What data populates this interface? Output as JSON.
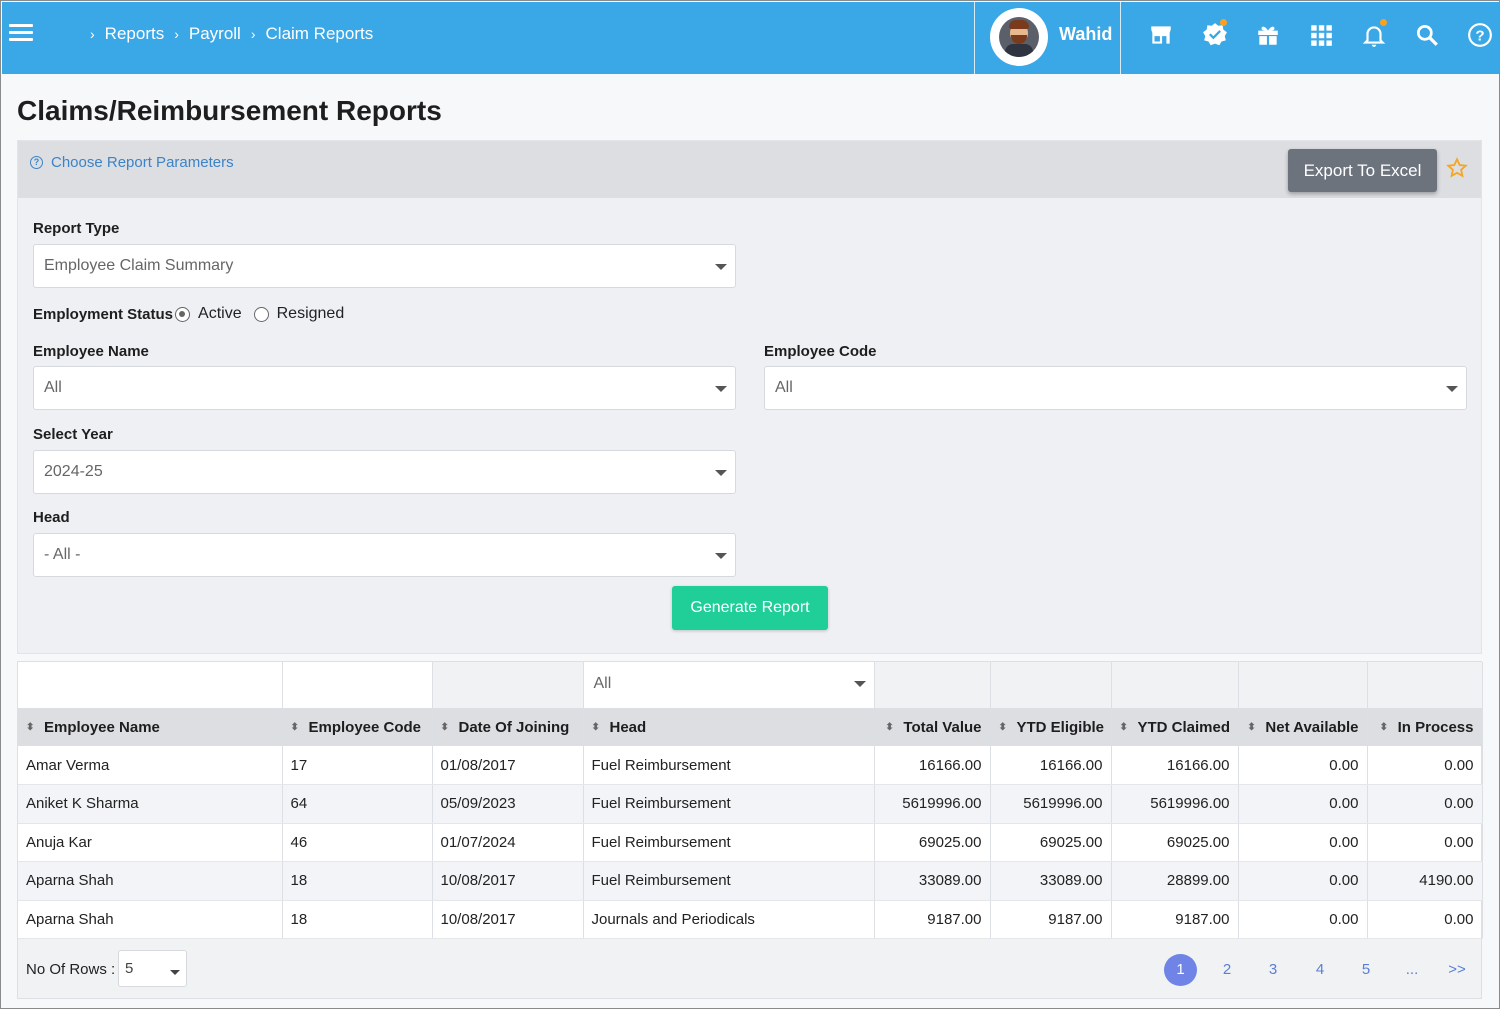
{
  "header": {
    "breadcrumbs": [
      "Reports",
      "Payroll",
      "Claim Reports"
    ],
    "username": "Wahid",
    "icons": [
      "store-icon",
      "verified-badge-icon",
      "gift-icon",
      "apps-grid-icon",
      "bell-icon",
      "search-icon",
      "help-icon"
    ],
    "accent": "#3aa7e6"
  },
  "page": {
    "title": "Claims/Reimbursement Reports"
  },
  "params": {
    "hint": "Choose Report Parameters",
    "export_label": "Export To Excel",
    "report_type_label": "Report Type",
    "report_type_value": "Employee Claim Summary",
    "employment_status_label": "Employment Status",
    "status_options": [
      "Active",
      "Resigned"
    ],
    "status_selected": "Active",
    "employee_name_label": "Employee Name",
    "employee_name_value": "All",
    "employee_code_label": "Employee Code",
    "employee_code_value": "All",
    "year_label": "Select Year",
    "year_value": "2024-25",
    "head_label": "Head",
    "head_value": "- All -",
    "generate_label": "Generate Report",
    "generate_color": "#1fcf97"
  },
  "table": {
    "head_filter_value": "All",
    "columns": [
      "Employee Name",
      "Employee Code",
      "Date Of Joining",
      "Head",
      "Total Value",
      "YTD Eligible",
      "YTD Claimed",
      "Net Available",
      "In Process"
    ],
    "rows": [
      [
        "Amar Verma",
        "17",
        "01/08/2017",
        "Fuel Reimbursement",
        "16166.00",
        "16166.00",
        "16166.00",
        "0.00",
        "0.00"
      ],
      [
        "Aniket K Sharma",
        "64",
        "05/09/2023",
        "Fuel Reimbursement",
        "5619996.00",
        "5619996.00",
        "5619996.00",
        "0.00",
        "0.00"
      ],
      [
        "Anuja Kar",
        "46",
        "01/07/2024",
        "Fuel Reimbursement",
        "69025.00",
        "69025.00",
        "69025.00",
        "0.00",
        "0.00"
      ],
      [
        "Aparna Shah",
        "18",
        "10/08/2017",
        "Fuel Reimbursement",
        "33089.00",
        "33089.00",
        "28899.00",
        "0.00",
        "4190.00"
      ],
      [
        "Aparna Shah",
        "18",
        "10/08/2017",
        "Journals and Periodicals",
        "9187.00",
        "9187.00",
        "9187.00",
        "0.00",
        "0.00"
      ]
    ],
    "rows_label": "No Of Rows :",
    "rows_value": "5",
    "pages": [
      "1",
      "2",
      "3",
      "4",
      "5",
      "...",
      ">>"
    ],
    "current_page": "1"
  }
}
